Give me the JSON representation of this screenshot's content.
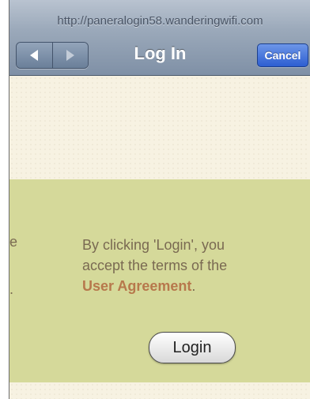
{
  "browser": {
    "url": "http://paneralogin58.wanderingwifi.com",
    "title": "Log In",
    "cancel_label": "Cancel",
    "back_icon": "back-arrow-icon",
    "forward_icon": "forward-arrow-icon"
  },
  "content": {
    "edge_glyphs": [
      "e",
      "."
    ],
    "terms_line1": "By clicking 'Login', you",
    "terms_line2": "accept the terms of the",
    "terms_link": "User Agreement",
    "terms_period": ".",
    "login_label": "Login"
  },
  "colors": {
    "cancel_button": "#2d5ed1",
    "panel_background": "#d5d99a",
    "link": "#b7784c",
    "body_text": "#7a6a52"
  }
}
